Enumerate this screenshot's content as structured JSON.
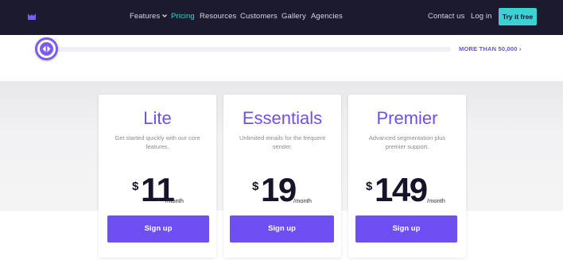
{
  "nav": {
    "links": {
      "features": "Features",
      "pricing": "Pricing",
      "resources": "Resources",
      "customers": "Customers",
      "gallery": "Gallery",
      "agencies": "Agencies",
      "contact": "Contact us",
      "login": "Log in"
    },
    "cta": "Try it free",
    "active": "Pricing"
  },
  "slider": {
    "label": "MORE THAN 50,000 ›",
    "level": 0
  },
  "plans": [
    {
      "name": "Lite",
      "description": "Get started quickly with our core features.",
      "currency": "$",
      "price": "11",
      "period": "/month",
      "button": "Sign up"
    },
    {
      "name": "Essentials",
      "description": "Unlimited emails for the frequent sender.",
      "currency": "$",
      "price": "19",
      "period": "/month",
      "button": "Sign up"
    },
    {
      "name": "Premier",
      "description": "Advanced segmentation plus premier support.",
      "currency": "$",
      "price": "149",
      "period": "/month",
      "button": "Sign up"
    }
  ],
  "colors": {
    "nav_bg": "#1b1a2e",
    "accent_teal": "#3fd0d4",
    "accent_purple": "#6f4ff2"
  }
}
